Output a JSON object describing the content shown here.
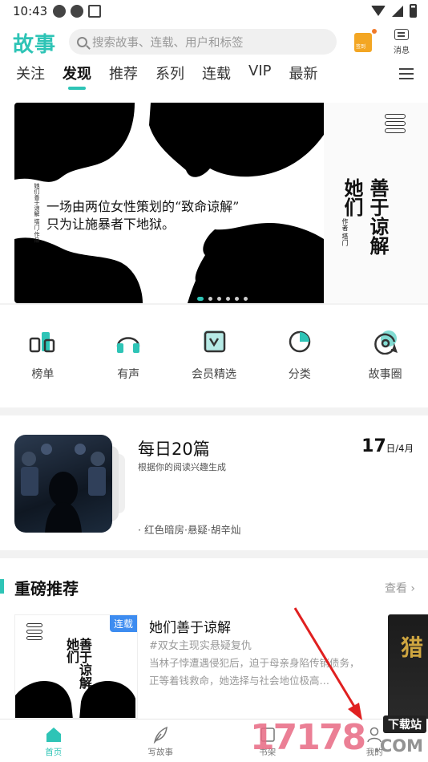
{
  "status_bar": {
    "time": "10:43"
  },
  "header": {
    "logo": "故事",
    "search_placeholder": "搜索故事、连载、用户和标签",
    "signin_label": "签到",
    "message_label": "消息",
    "tabs": [
      {
        "label": "关注",
        "active": false
      },
      {
        "label": "发现",
        "active": true
      },
      {
        "label": "推荐",
        "active": false
      },
      {
        "label": "系列",
        "active": false
      },
      {
        "label": "连载",
        "active": false
      },
      {
        "label": "VIP",
        "active": false
      },
      {
        "label": "最新",
        "active": false
      }
    ]
  },
  "banner": {
    "line1": "一场由两位女性策划的“致命谅解”",
    "line2": "只为让施暴者下地狱。",
    "side_text": "她们善于谅解 塔门·作品",
    "book_title_a": "善于谅解",
    "book_title_b": "她们",
    "author": "作者 塔门",
    "dot_count": 6,
    "active_dot": 0
  },
  "quick_nav": [
    {
      "label": "榜单",
      "icon": "ranking-icon"
    },
    {
      "label": "有声",
      "icon": "headphones-icon"
    },
    {
      "label": "会员精选",
      "icon": "vip-selection-icon"
    },
    {
      "label": "分类",
      "icon": "category-icon"
    },
    {
      "label": "故事圈",
      "icon": "story-circle-icon"
    }
  ],
  "daily": {
    "title": "每日20篇",
    "subtitle": "根据你的阅读兴趣生成",
    "tags": "· 红色暗房·悬疑·胡辛灿",
    "day": "17",
    "month": "日/4月"
  },
  "recommend": {
    "section_title": "重磅推荐",
    "more_label": "查看",
    "book": {
      "badge": "连载",
      "title": "她们善于谅解",
      "tag": "#双女主现实悬疑复仇",
      "description": "当林子悖遭遇侵犯后，迫于母亲身陷传销债务，正等着钱救命，她选择与社会地位极高…",
      "cover_title_a": "善于谅解",
      "cover_title_b": "她们"
    },
    "next_cover_text": "猎"
  },
  "bottom_nav": [
    {
      "label": "首页",
      "icon": "home-icon",
      "active": true
    },
    {
      "label": "写故事",
      "icon": "feather-icon",
      "active": false
    },
    {
      "label": "书架",
      "icon": "bookshelf-icon",
      "active": false
    },
    {
      "label": "我的",
      "icon": "profile-icon",
      "active": false
    }
  ],
  "watermark": {
    "number": "17178",
    "badge": "下载站",
    "domain": ".COM"
  },
  "colors": {
    "accent": "#2ec4b6",
    "badge_blue": "#3d8cf0",
    "annotation_red": "#e02020"
  }
}
